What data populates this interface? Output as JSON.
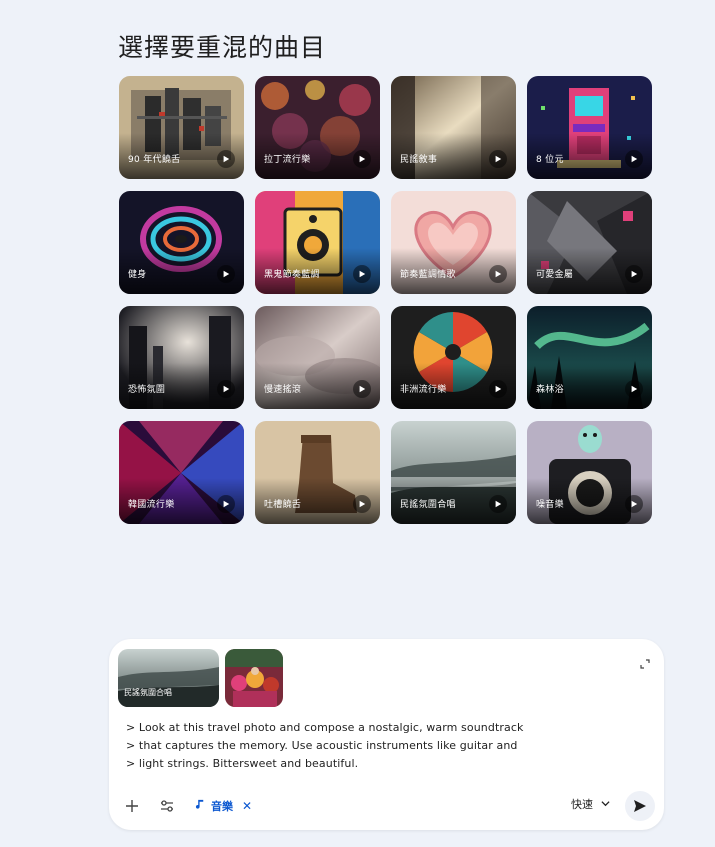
{
  "page": {
    "title": "選擇要重混的曲目"
  },
  "tracks": [
    {
      "label": "90 年代饒舌"
    },
    {
      "label": "拉丁流行樂"
    },
    {
      "label": "民謠敘事"
    },
    {
      "label": "8 位元"
    },
    {
      "label": "健身"
    },
    {
      "label": "黑鬼節奏藍調"
    },
    {
      "label": "節奏藍調情歌"
    },
    {
      "label": "可愛金屬"
    },
    {
      "label": "恐怖氛圍"
    },
    {
      "label": "慢速搖滾"
    },
    {
      "label": "非洲流行樂"
    },
    {
      "label": "森林浴"
    },
    {
      "label": "韓國流行樂"
    },
    {
      "label": "吐槽饒舌"
    },
    {
      "label": "民謠氛圍合唱"
    },
    {
      "label": "噪音樂"
    }
  ],
  "composer": {
    "attachments": [
      {
        "label": "民謠氛圍合唱"
      },
      {
        "label": ""
      }
    ],
    "prompt_lines": [
      "> Look at this travel photo and compose a nostalgic, warm soundtrack",
      "> that captures the memory. Use acoustic instruments like guitar and",
      "> light strings. Bittersweet and beautiful."
    ],
    "chip_label": "音樂",
    "mode_label": "快速"
  },
  "icons": {
    "add": "plus-icon",
    "tools": "sliders-icon",
    "music": "music-note-icon",
    "remove": "close-icon",
    "dropdown": "chevron-down-icon",
    "send": "send-icon",
    "expand": "expand-icon",
    "play": "play-icon"
  },
  "colors": {
    "accent": "#0b57d0",
    "background": "#eef2f9"
  }
}
